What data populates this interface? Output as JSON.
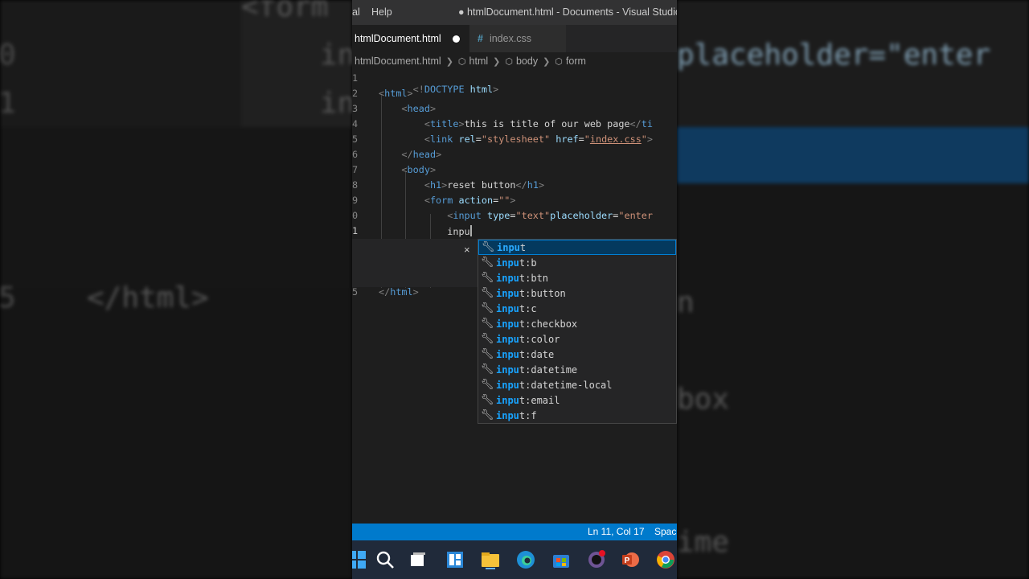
{
  "titlebar": {
    "menu_partial": "al",
    "menu_help": "Help",
    "title": "● htmlDocument.html - Documents - Visual Studio C"
  },
  "tabs": [
    {
      "label": "htmlDocument.html",
      "modified": true
    },
    {
      "label": "index.css",
      "icon": "#"
    }
  ],
  "breadcrumbs": [
    "htmlDocument.html",
    "html",
    "body",
    "form"
  ],
  "editor": {
    "line_numbers": [
      "1",
      "2",
      "3",
      "4",
      "5",
      "6",
      "7",
      "8",
      "9",
      "0",
      "1",
      "5"
    ],
    "lines": [
      "<!DOCTYPE html>",
      "<html>",
      "<head>",
      "<title>this is title of our web page</ti",
      "<link rel=\"stylesheet\" href=\"index.css\">",
      "</head>",
      "<body>",
      "<h1>reset button</h1>",
      "<form action=\"\">",
      "<input type=\"text\"placeholder=\"enter",
      "inpu",
      "</html>"
    ]
  },
  "suggest": {
    "close_glyph": "×",
    "match": "inpu",
    "items": [
      "input",
      "input:b",
      "input:btn",
      "input:button",
      "input:c",
      "input:checkbox",
      "input:color",
      "input:date",
      "input:datetime",
      "input:datetime-local",
      "input:email",
      "input:f"
    ]
  },
  "status": {
    "position": "Ln 11, Col 17",
    "spaces": "Spac"
  },
  "background": {
    "left_tokens": [
      "<form",
      "0",
      "1",
      "5",
      "</html>",
      "in",
      "in"
    ],
    "right_tokens": [
      "placeholder=\"enter",
      "n",
      "box",
      "ime"
    ]
  },
  "taskbar": {
    "icons": [
      "windows-icon",
      "search-icon",
      "task-view-icon",
      "widgets-icon",
      "file-explorer-icon",
      "edge-icon",
      "store-icon",
      "github-desktop-icon",
      "powerpoint-icon",
      "chrome-icon"
    ]
  },
  "colors": {
    "accent": "#007acc",
    "selection": "#04395e",
    "editor_bg": "#1e1e1e"
  }
}
